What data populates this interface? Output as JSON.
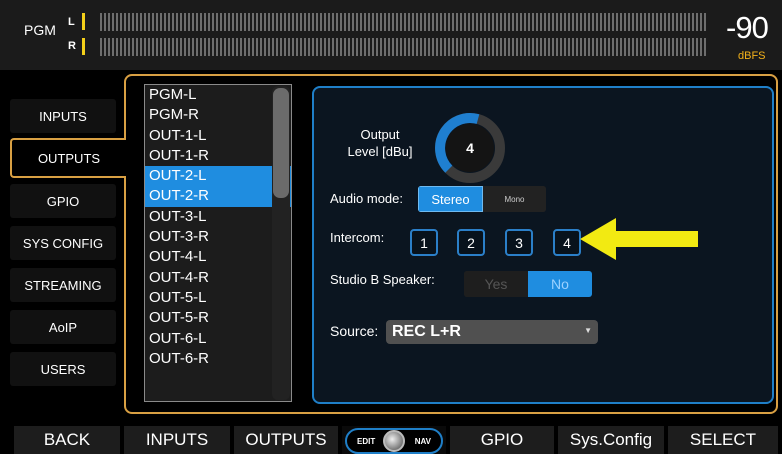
{
  "meter": {
    "label": "PGM",
    "left_channel": "L",
    "right_channel": "R",
    "value": "-90",
    "unit": "dBFS",
    "tick_color": "#f4d01a",
    "unit_color": "#f4b21a"
  },
  "nav": {
    "items": [
      {
        "label": "INPUTS"
      },
      {
        "label": "OUTPUTS",
        "active": true
      },
      {
        "label": "GPIO"
      },
      {
        "label": "SYS CONFIG"
      },
      {
        "label": "STREAMING"
      },
      {
        "label": "AoIP"
      },
      {
        "label": "USERS"
      }
    ],
    "active_border_color": "#d9a043"
  },
  "channels": [
    {
      "label": "PGM-L"
    },
    {
      "label": "PGM-R"
    },
    {
      "label": "OUT-1-L"
    },
    {
      "label": "OUT-1-R"
    },
    {
      "label": "OUT-2-L",
      "selected": true
    },
    {
      "label": "OUT-2-R",
      "selected": true
    },
    {
      "label": "OUT-3-L"
    },
    {
      "label": "OUT-3-R"
    },
    {
      "label": "OUT-4-L"
    },
    {
      "label": "OUT-4-R"
    },
    {
      "label": "OUT-5-L"
    },
    {
      "label": "OUT-5-R"
    },
    {
      "label": "OUT-6-L"
    },
    {
      "label": "OUT-6-R"
    }
  ],
  "settings": {
    "output_level_label_line1": "Output",
    "output_level_label_line2": "Level [dBu]",
    "output_level_value": "4",
    "audio_mode_label": "Audio mode:",
    "audio_mode_options": [
      "Stereo",
      "Mono"
    ],
    "audio_mode_selected": "Stereo",
    "intercom_label": "Intercom:",
    "intercom_buttons": [
      "1",
      "2",
      "3",
      "4"
    ],
    "studio_b_label": "Studio B Speaker:",
    "studio_b_options": [
      "Yes",
      "No"
    ],
    "studio_b_selected": "No",
    "source_label": "Source:",
    "source_value": "REC L+R",
    "accent_color": "#1f8de0"
  },
  "bottom_bar": {
    "back": "BACK",
    "inputs": "INPUTS",
    "outputs": "OUTPUTS",
    "edit": "EDIT",
    "nav": "NAV",
    "gpio": "GPIO",
    "sysconfig": "Sys.Config",
    "select": "SELECT"
  },
  "annotation": {
    "arrow_color": "#f2ea12",
    "points_to": "intercom-button-4"
  }
}
